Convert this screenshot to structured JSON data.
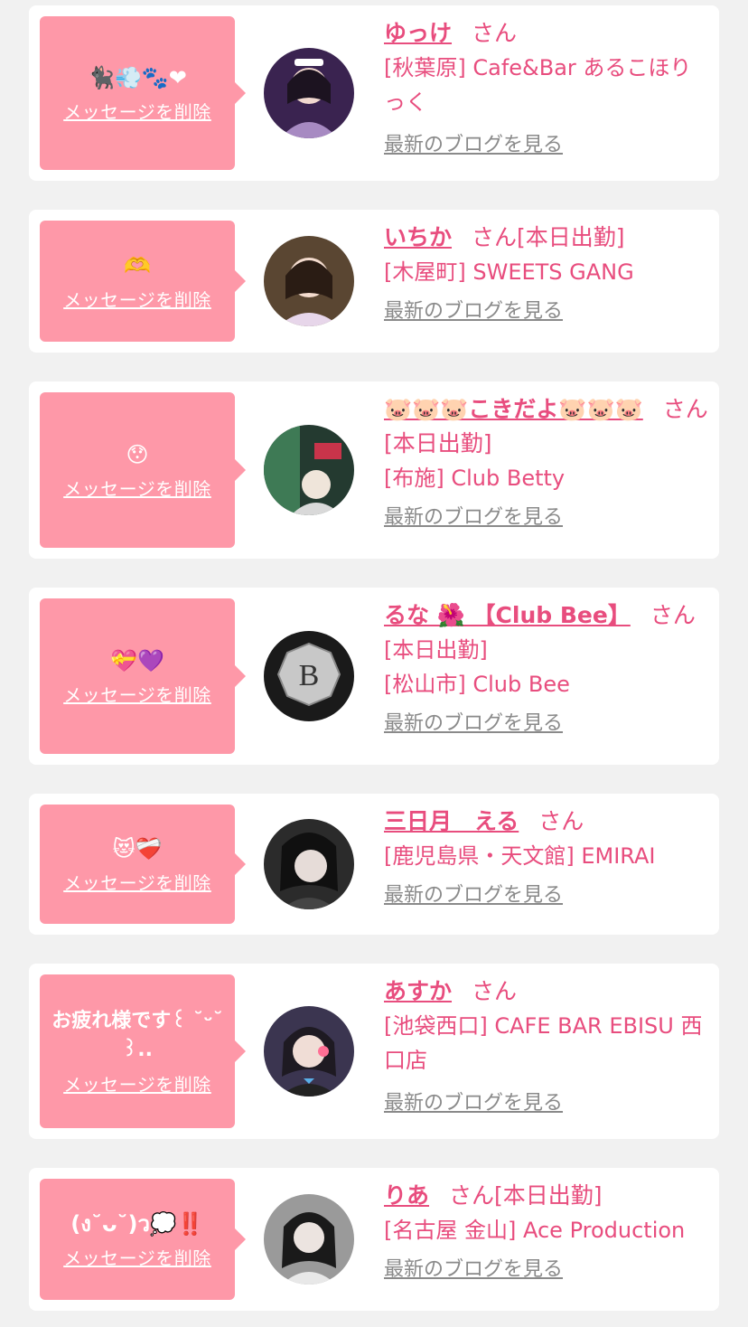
{
  "delete_label": "メッセージを削除",
  "blog_label": "最新のブログを見る",
  "honorific": "さん",
  "colors": {
    "accent": "#e84d7e",
    "bubble": "#fe98a8",
    "background": "#f1f1f1",
    "link_gray": "#8a8a8a"
  },
  "cards": [
    {
      "message": "🐈‍⬛💨🐾❤",
      "name": "ゆっけ",
      "status": "",
      "shop": "[秋葉原] Cafe&Bar あるこほりっく",
      "avatar_icon": "user-photo"
    },
    {
      "message": "🫶",
      "name": "いちか",
      "status": "[本日出勤]",
      "shop": "[木屋町] SWEETS GANG",
      "avatar_icon": "user-photo"
    },
    {
      "message": "😯",
      "name": "🐷🐷🐷こきだよ🐷🐷🐷",
      "status": "[本日出勤]",
      "shop": "[布施] Club Betty",
      "avatar_icon": "user-photo"
    },
    {
      "message": "💝💜",
      "name": "るな 🌺 【Club Bee】",
      "status": "[本日出勤]",
      "shop": "[松山市] Club Bee",
      "avatar_icon": "club-logo-b"
    },
    {
      "message": "😻❤️‍🩹",
      "name": "三日月　える",
      "status": "",
      "shop": "[鹿児島県・天文館] EMIRAI",
      "avatar_icon": "user-photo"
    },
    {
      "message": "お疲れ様です꒰ ˘ᵕ˘ ꒱..",
      "name": "あすか",
      "status": "",
      "shop": "[池袋西口] CAFE BAR EBISU 西口店",
      "avatar_icon": "user-photo"
    },
    {
      "message": "(ง˘ᴗ˘)ว💭‼️",
      "name": "りあ",
      "status": "[本日出勤]",
      "shop": "[名古屋 金山] Ace Production",
      "avatar_icon": "user-photo"
    }
  ]
}
